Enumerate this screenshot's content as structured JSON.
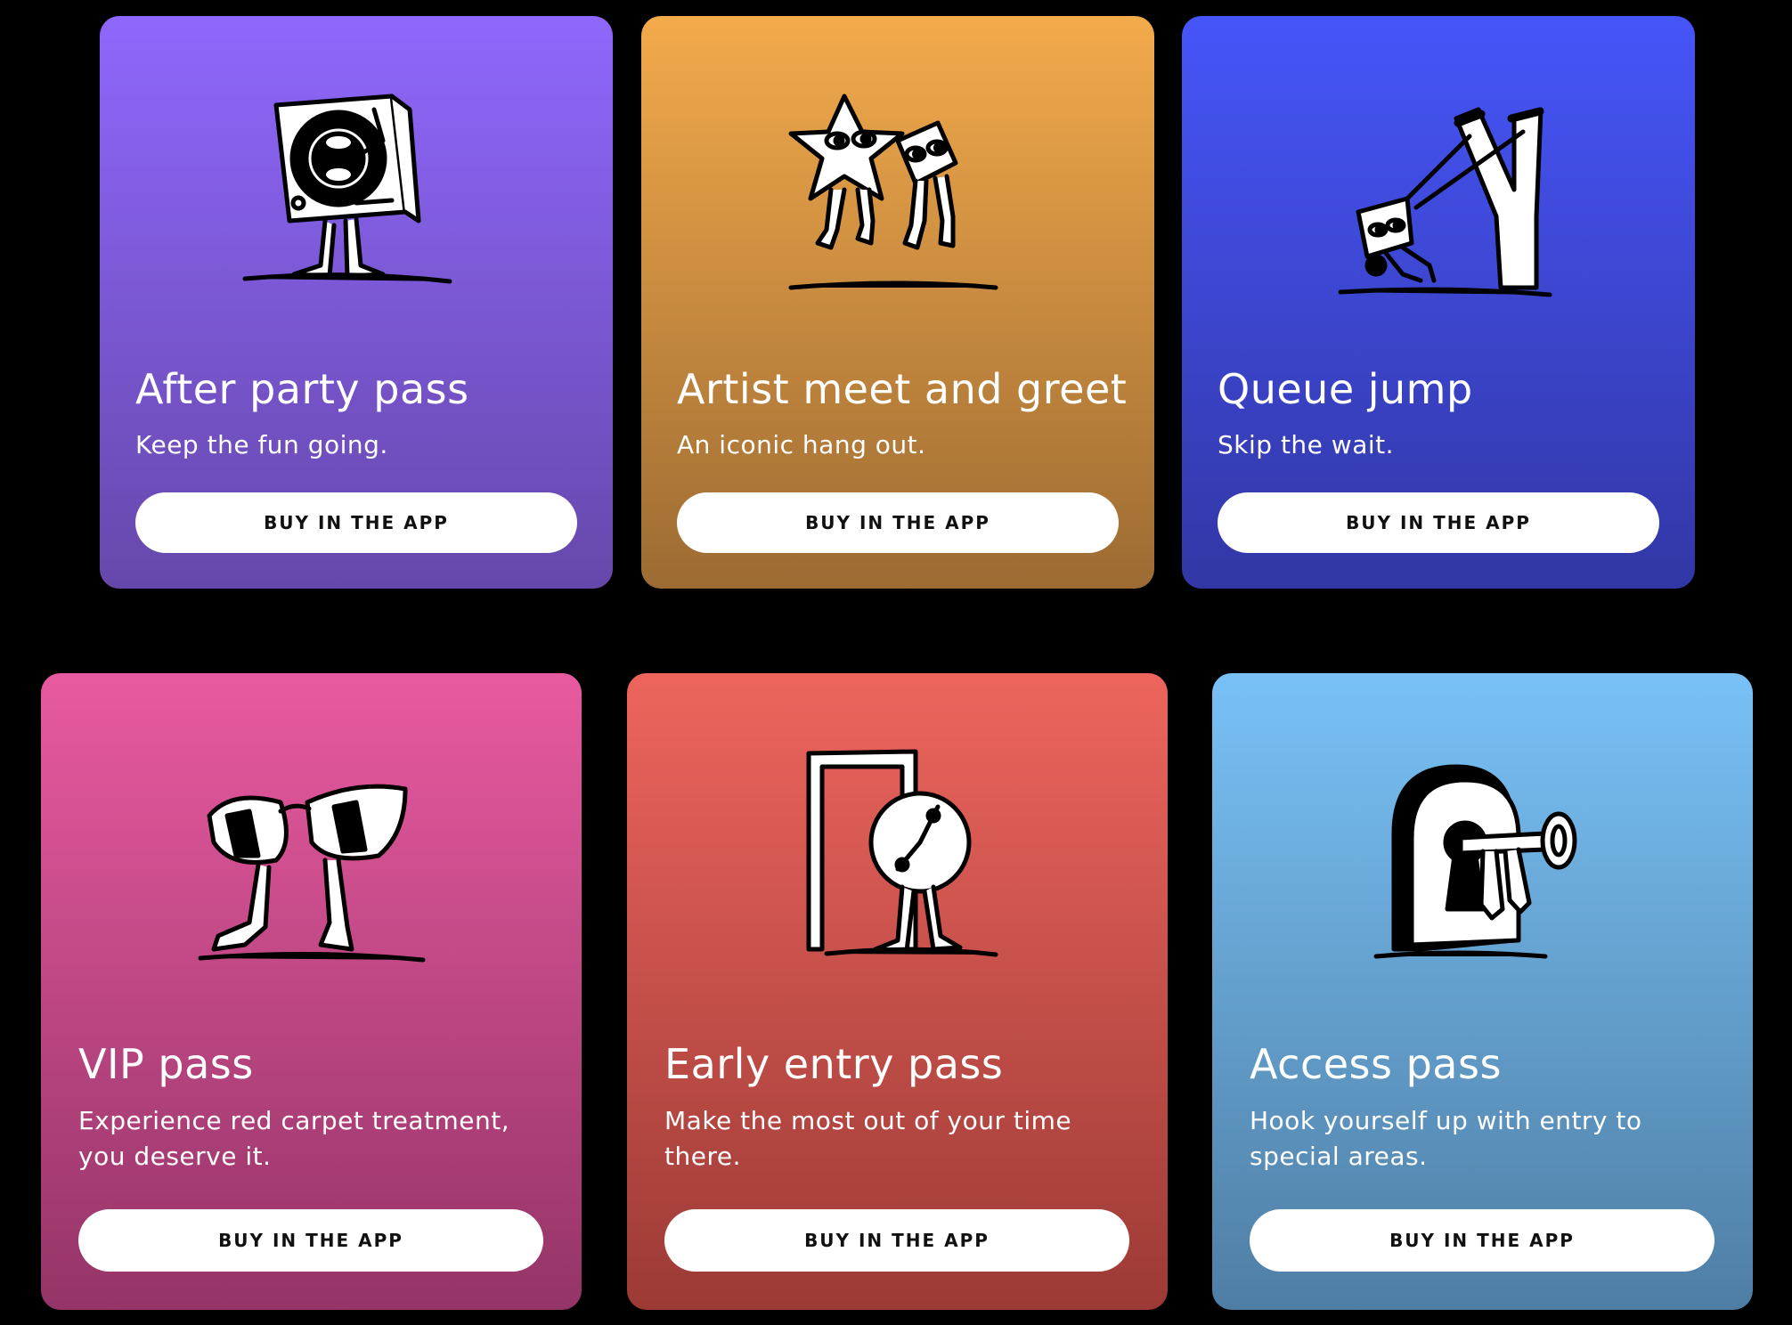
{
  "cards": [
    {
      "title": "After party pass",
      "subtitle": "Keep the fun going.",
      "button_label": "BUY IN THE APP",
      "illustration": "turntable-character-icon",
      "gradient": [
        "#8f67fc",
        "#6648ab"
      ]
    },
    {
      "title": "Artist meet and greet",
      "subtitle": "An iconic hang out.",
      "button_label": "BUY IN THE APP",
      "illustration": "star-and-diamond-characters-icon",
      "gradient": [
        "#f3aa4b",
        "#9c6b33"
      ]
    },
    {
      "title": "Queue jump",
      "subtitle": "Skip the wait.",
      "button_label": "BUY IN THE APP",
      "illustration": "slingshot-character-icon",
      "gradient": [
        "#4655f9",
        "#3237a5"
      ]
    },
    {
      "title": "VIP pass",
      "subtitle": "Experience red carpet treatment, you deserve it.",
      "button_label": "BUY IN THE APP",
      "illustration": "sunglasses-character-icon",
      "gradient": [
        "#e85aa0",
        "#943467"
      ]
    },
    {
      "title": "Early entry pass",
      "subtitle": "Make the most out of your time there.",
      "button_label": "BUY IN THE APP",
      "illustration": "door-and-clock-character-icon",
      "gradient": [
        "#ed655d",
        "#9c3a36"
      ]
    },
    {
      "title": "Access pass",
      "subtitle": "Hook yourself up with entry to special areas.",
      "button_label": "BUY IN THE APP",
      "illustration": "keyhole-and-key-character-icon",
      "gradient": [
        "#78c1f6",
        "#4f7ea4"
      ]
    }
  ]
}
